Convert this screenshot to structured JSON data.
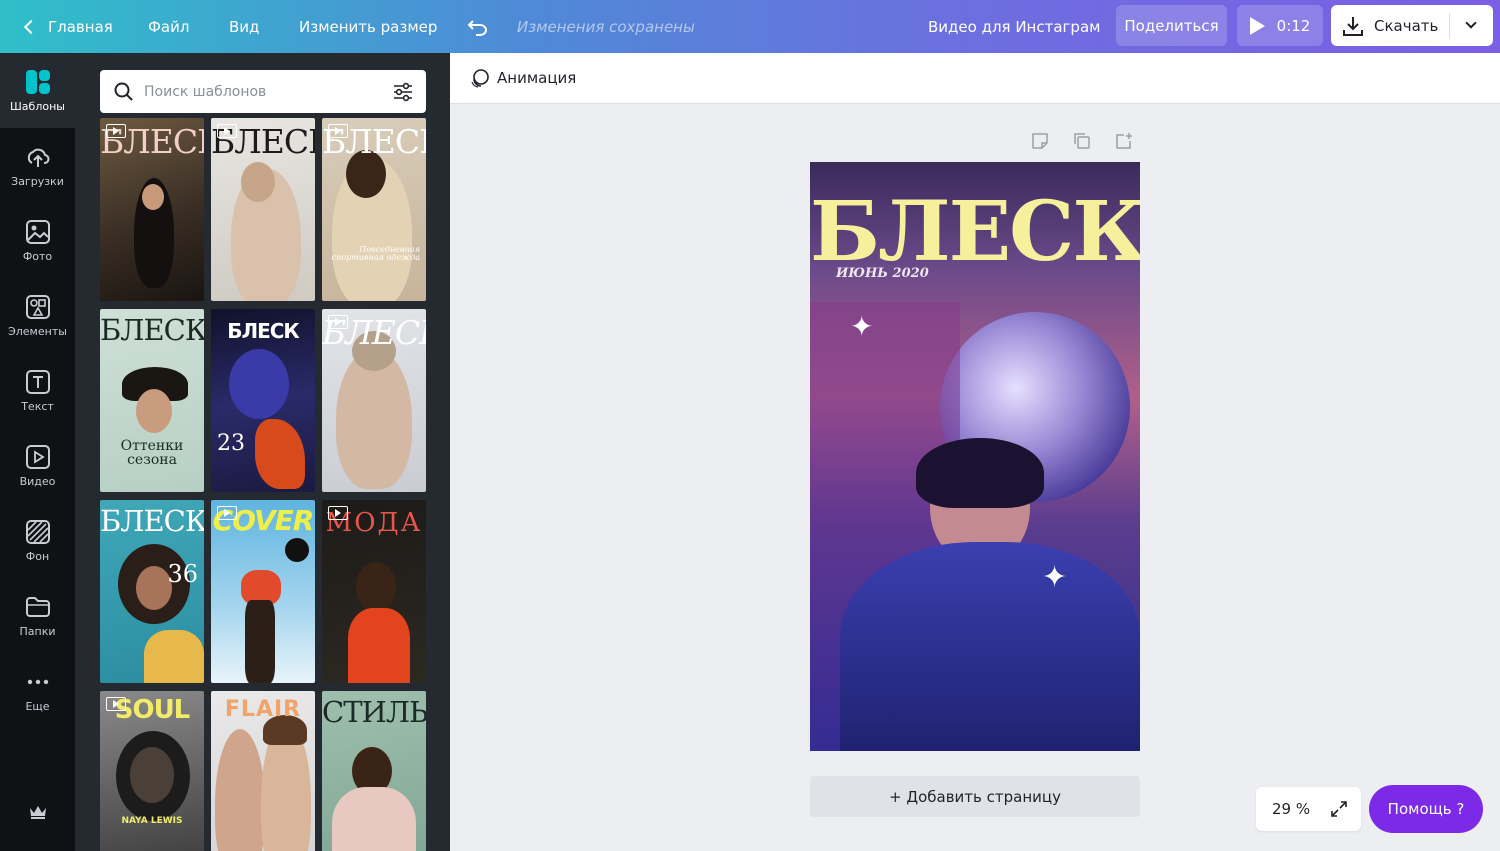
{
  "topbar": {
    "home": "Главная",
    "file": "Файл",
    "view": "Вид",
    "resize": "Изменить размер",
    "saved_status": "Изменения сохранены",
    "doc_title": "Видео для Инстаграм",
    "share": "Поделиться",
    "play_time": "0:12",
    "download": "Скачать"
  },
  "rail": {
    "items": [
      {
        "label": "Шаблоны",
        "icon": "templates-icon"
      },
      {
        "label": "Загрузки",
        "icon": "upload-icon"
      },
      {
        "label": "Фото",
        "icon": "photo-icon"
      },
      {
        "label": "Элементы",
        "icon": "elements-icon"
      },
      {
        "label": "Текст",
        "icon": "text-icon"
      },
      {
        "label": "Видео",
        "icon": "video-icon"
      },
      {
        "label": "Фон",
        "icon": "background-icon"
      },
      {
        "label": "Папки",
        "icon": "folder-icon"
      },
      {
        "label": "Еще",
        "icon": "more-icon"
      }
    ]
  },
  "search": {
    "placeholder": "Поиск шаблонов"
  },
  "templates": [
    {
      "title": "БЛЕСК",
      "video": true
    },
    {
      "title": "БЛЕСК",
      "video": true
    },
    {
      "title": "БЛЕСК",
      "video": true,
      "caption": "Повседневная спортивная одежда"
    },
    {
      "title": "БЛЕСК",
      "video": false,
      "caption": "Оттенки сезона"
    },
    {
      "title": "БЛЕСК",
      "video": false,
      "caption": "23"
    },
    {
      "title": "БЛЕСК",
      "video": true
    },
    {
      "title": "БЛЕСК",
      "video": false,
      "caption": "36"
    },
    {
      "title": "COVER",
      "video": true
    },
    {
      "title": "МОДА",
      "video": true
    },
    {
      "title": "SOUL",
      "video": true,
      "caption": "NAYA LEWIS"
    },
    {
      "title": "FLAIR",
      "video": false
    },
    {
      "title": "СТИЛЬ",
      "video": false
    }
  ],
  "editor": {
    "animation": "Анимация",
    "page_title": "БЛЕСК",
    "page_date": "ИЮНЬ 2020",
    "add_page": "+ Добавить страницу",
    "zoom": "29 %",
    "help": "Помощь ?"
  },
  "colors": {
    "accent": "#7d2ae8",
    "topbar_start": "#2fbfc9",
    "topbar_end": "#7b5fe4",
    "title_yellow": "#f6ef9c",
    "rail_bg": "#0f1215",
    "panel_bg": "#252a30"
  }
}
